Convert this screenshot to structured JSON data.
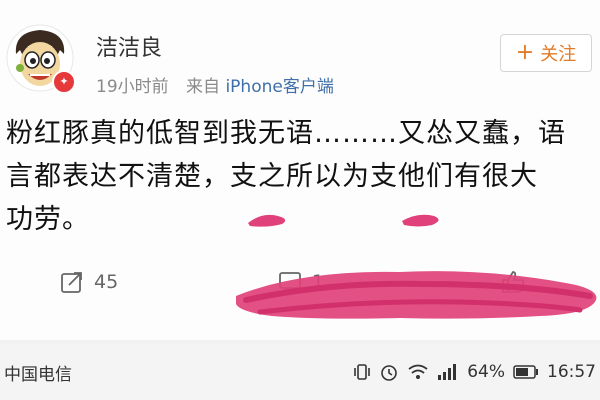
{
  "post": {
    "username": "洁洁良",
    "time": "19小时前",
    "source_prefix": "来自",
    "device": "iPhone客户端",
    "follow_label": "关注",
    "text": "粉红豚真的低智到我无语………又怂又蠢，语\n言都表达不清楚，支之所以为支他们有很大\n功劳。"
  },
  "actions": {
    "repost_count": "45",
    "comment_count": "1"
  },
  "status_bar": {
    "carrier": "中国电信",
    "battery": "64%",
    "time": "16:57"
  },
  "colors": {
    "follow_text": "#e27b26",
    "device_link": "#3f6fa8",
    "scribble": "#e0417a",
    "verified_badge": "#e5393b"
  }
}
